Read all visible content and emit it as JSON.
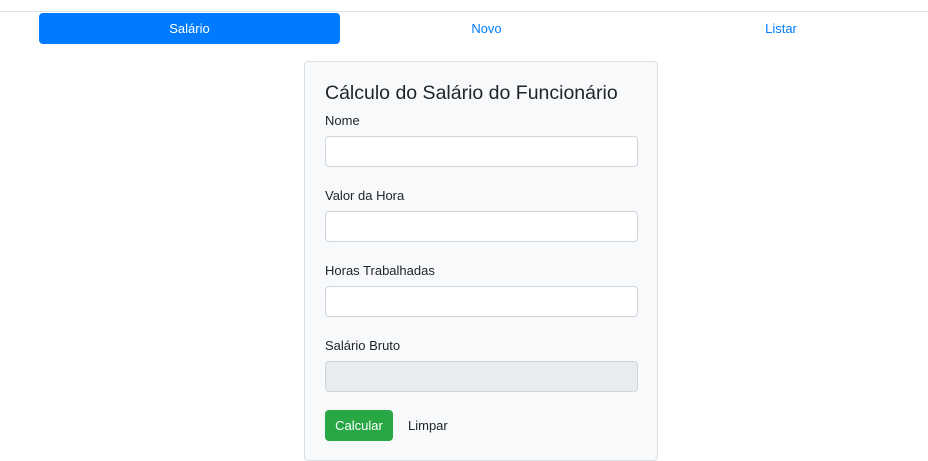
{
  "nav": {
    "tabs": [
      {
        "label": "Salário",
        "active": true
      },
      {
        "label": "Novo",
        "active": false
      },
      {
        "label": "Listar",
        "active": false
      }
    ]
  },
  "form": {
    "title": "Cálculo do Salário do Funcionário",
    "fields": [
      {
        "label": "Nome",
        "value": "",
        "readonly": false
      },
      {
        "label": "Valor da Hora",
        "value": "",
        "readonly": false
      },
      {
        "label": "Horas Trabalhadas",
        "value": "",
        "readonly": false
      },
      {
        "label": "Salário Bruto",
        "value": "",
        "readonly": true
      }
    ],
    "calculate_label": "Calcular",
    "clear_label": "Limpar"
  },
  "colors": {
    "primary": "#007bff",
    "success": "#28a745",
    "card_bg": "#f8f9fa",
    "readonly_bg": "#e9ecef"
  }
}
